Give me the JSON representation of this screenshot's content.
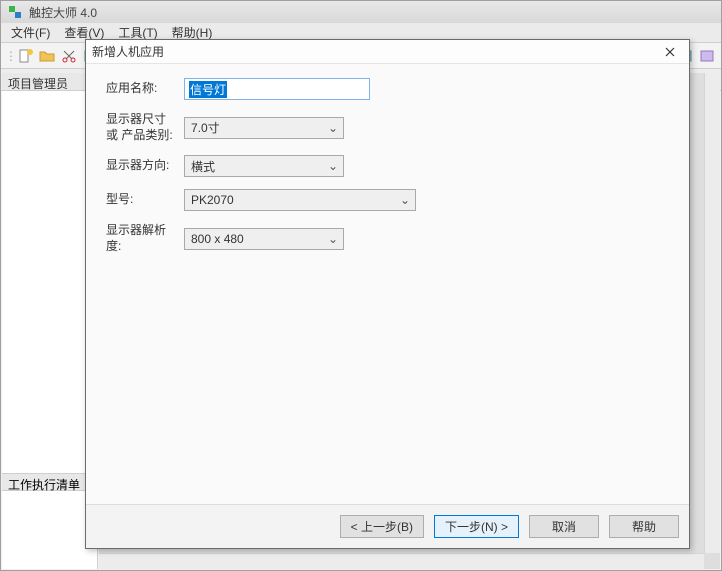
{
  "app": {
    "title": "触控大师 4.0"
  },
  "menu": {
    "file": "文件(F)",
    "view": "查看(V)",
    "tools": "工具(T)",
    "help": "帮助(H)"
  },
  "panels": {
    "project_manager": "项目管理员",
    "work_execution": "工作执行清单"
  },
  "toolbar_icons": {
    "new": "new-file-icon",
    "open": "open-icon",
    "cut": "cut-icon",
    "img": "image-icon",
    "delete": "delete-icon",
    "props": "props-icon"
  },
  "dialog": {
    "title": "新增人机应用",
    "labels": {
      "app_name": "应用名称:",
      "display_size": "显示器尺寸 或 产品类别:",
      "orientation": "显示器方向:",
      "model": "型号:",
      "resolution": "显示器解析度:"
    },
    "values": {
      "app_name": "信号灯",
      "display_size": "7.0寸",
      "orientation": "横式",
      "model": "PK2070",
      "resolution": "800 x 480"
    },
    "buttons": {
      "back": "< 上一步(B)",
      "next": "下一步(N) >",
      "cancel": "取消",
      "help": "帮助"
    }
  }
}
